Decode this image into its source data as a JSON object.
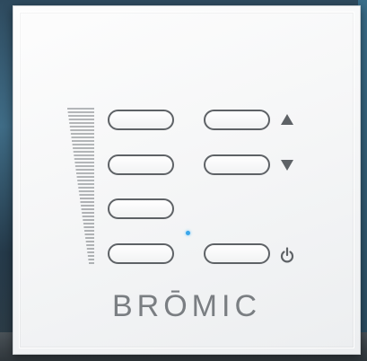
{
  "brand": {
    "name": "BRŌMIC"
  },
  "colors": {
    "panel": "#f4f5f6",
    "button_outline": "#5e6266",
    "icon": "#5e6266",
    "led": "#3aa6ea",
    "brand_text": "#7a7e82"
  },
  "controls": {
    "left_buttons": [
      {
        "name": "level-1-button"
      },
      {
        "name": "level-2-button"
      },
      {
        "name": "level-3-button"
      },
      {
        "name": "level-4-button"
      }
    ],
    "right_buttons": [
      {
        "name": "up-button",
        "icon": "triangle-up-icon"
      },
      {
        "name": "down-button",
        "icon": "triangle-down-icon"
      },
      {
        "name": "power-button",
        "icon": "power-icon"
      }
    ]
  },
  "status": {
    "led_on": true,
    "led_color": "#3aa6ea"
  }
}
